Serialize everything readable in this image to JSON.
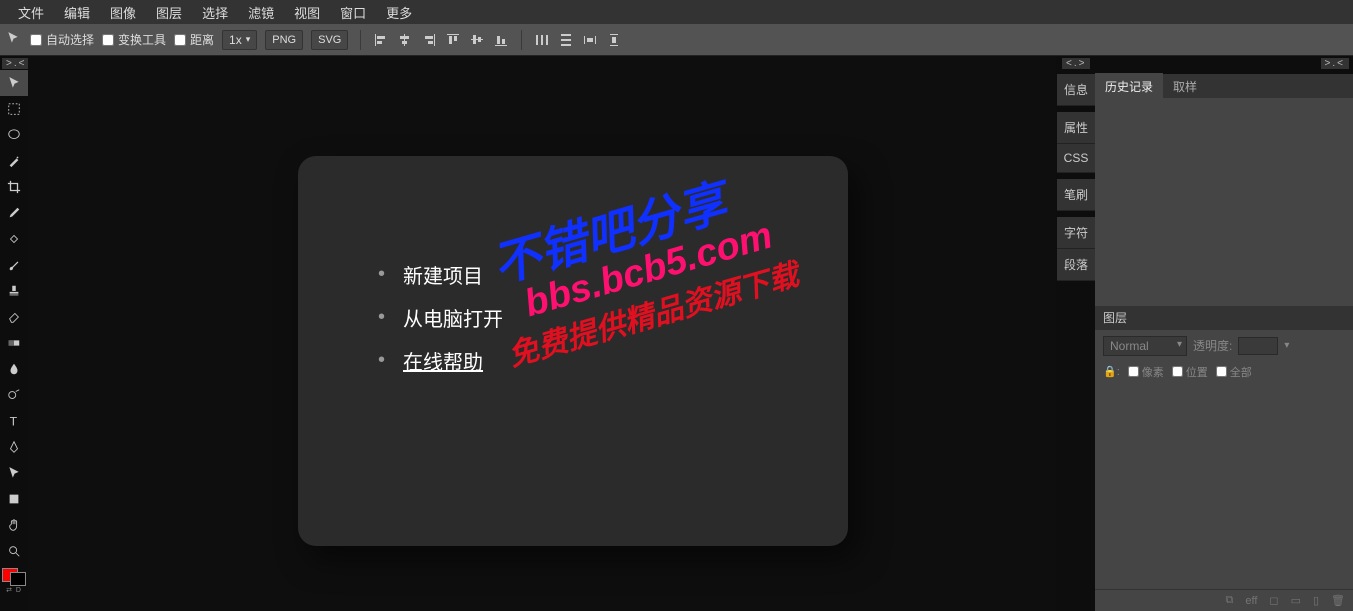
{
  "menu": [
    "文件",
    "编辑",
    "图像",
    "图层",
    "选择",
    "滤镜",
    "视图",
    "窗口",
    "更多"
  ],
  "optbar": {
    "auto_select": "自动选择",
    "transform": "变换工具",
    "distance": "距离",
    "scale": "1x",
    "fmt1": "PNG",
    "fmt2": "SVG"
  },
  "collapse": {
    "left": ">.<",
    "r1": "<.>",
    "r2": ">.<"
  },
  "welcome": {
    "items": [
      "新建项目",
      "从电脑打开",
      "在线帮助"
    ]
  },
  "watermark": {
    "l1": "不错吧分享",
    "l2": "bbs.bcb5.com",
    "l3": "免费提供精品资源下载"
  },
  "vtabs": [
    "信息",
    "属性",
    "CSS",
    "笔刷",
    "字符",
    "段落"
  ],
  "rtabs": {
    "history": "历史记录",
    "sample": "取样"
  },
  "layers": {
    "title": "图层",
    "blend": "Normal",
    "opacity_label": "透明度:",
    "lock_px": "像素",
    "lock_pos": "位置",
    "lock_all": "全部",
    "foot": [
      "�linkedin",
      "eff",
      "◻",
      "▭",
      "✕"
    ]
  },
  "footicons": [
    "⧉",
    "eff",
    "▭",
    "▭",
    "▯",
    "🗑"
  ]
}
